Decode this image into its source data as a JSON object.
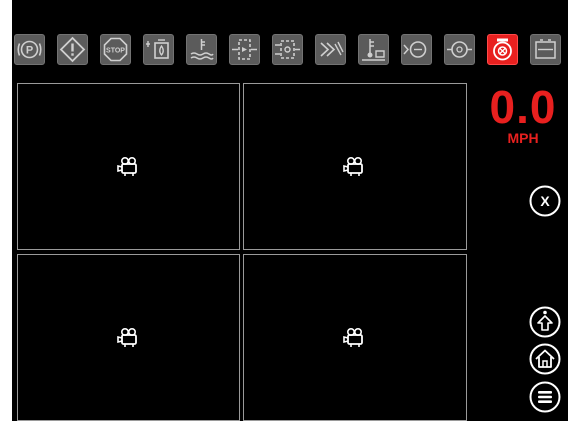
{
  "toolbar": {
    "telltales": [
      {
        "icon": "park-brake-icon",
        "state": "inactive"
      },
      {
        "icon": "warning-diamond-icon",
        "state": "inactive"
      },
      {
        "icon": "stop-icon",
        "state": "inactive",
        "label": "STOP"
      },
      {
        "icon": "fuel-water-separator-icon",
        "state": "inactive"
      },
      {
        "icon": "coolant-level-icon",
        "state": "inactive"
      },
      {
        "icon": "hydraulic-filter-icon",
        "state": "inactive"
      },
      {
        "icon": "transmission-filter-icon",
        "state": "inactive"
      },
      {
        "icon": "air-filter-icon",
        "state": "inactive"
      },
      {
        "icon": "hydraulic-oil-temp-icon",
        "state": "inactive"
      },
      {
        "icon": "engine-oil-pressure-icon",
        "state": "inactive"
      },
      {
        "icon": "transmission-oil-pressure-icon",
        "state": "inactive"
      },
      {
        "icon": "engine-fault-icon",
        "state": "active"
      },
      {
        "icon": "battery-icon",
        "state": "inactive"
      }
    ]
  },
  "cameras": [
    {
      "icon": "camera-icon"
    },
    {
      "icon": "camera-icon"
    },
    {
      "icon": "camera-icon"
    },
    {
      "icon": "camera-icon"
    }
  ],
  "speed": {
    "value": "0.0",
    "unit": "MPH"
  },
  "colors": {
    "accent": "#e8201f",
    "tile": "#5b5b5b",
    "background": "#000000",
    "border": "#9a9a9a"
  },
  "side_buttons": {
    "close": {
      "label": "X",
      "icon": "close-icon"
    },
    "upshift": {
      "icon": "up-arrow-icon"
    },
    "home": {
      "icon": "home-icon"
    },
    "menu": {
      "icon": "menu-icon"
    }
  }
}
